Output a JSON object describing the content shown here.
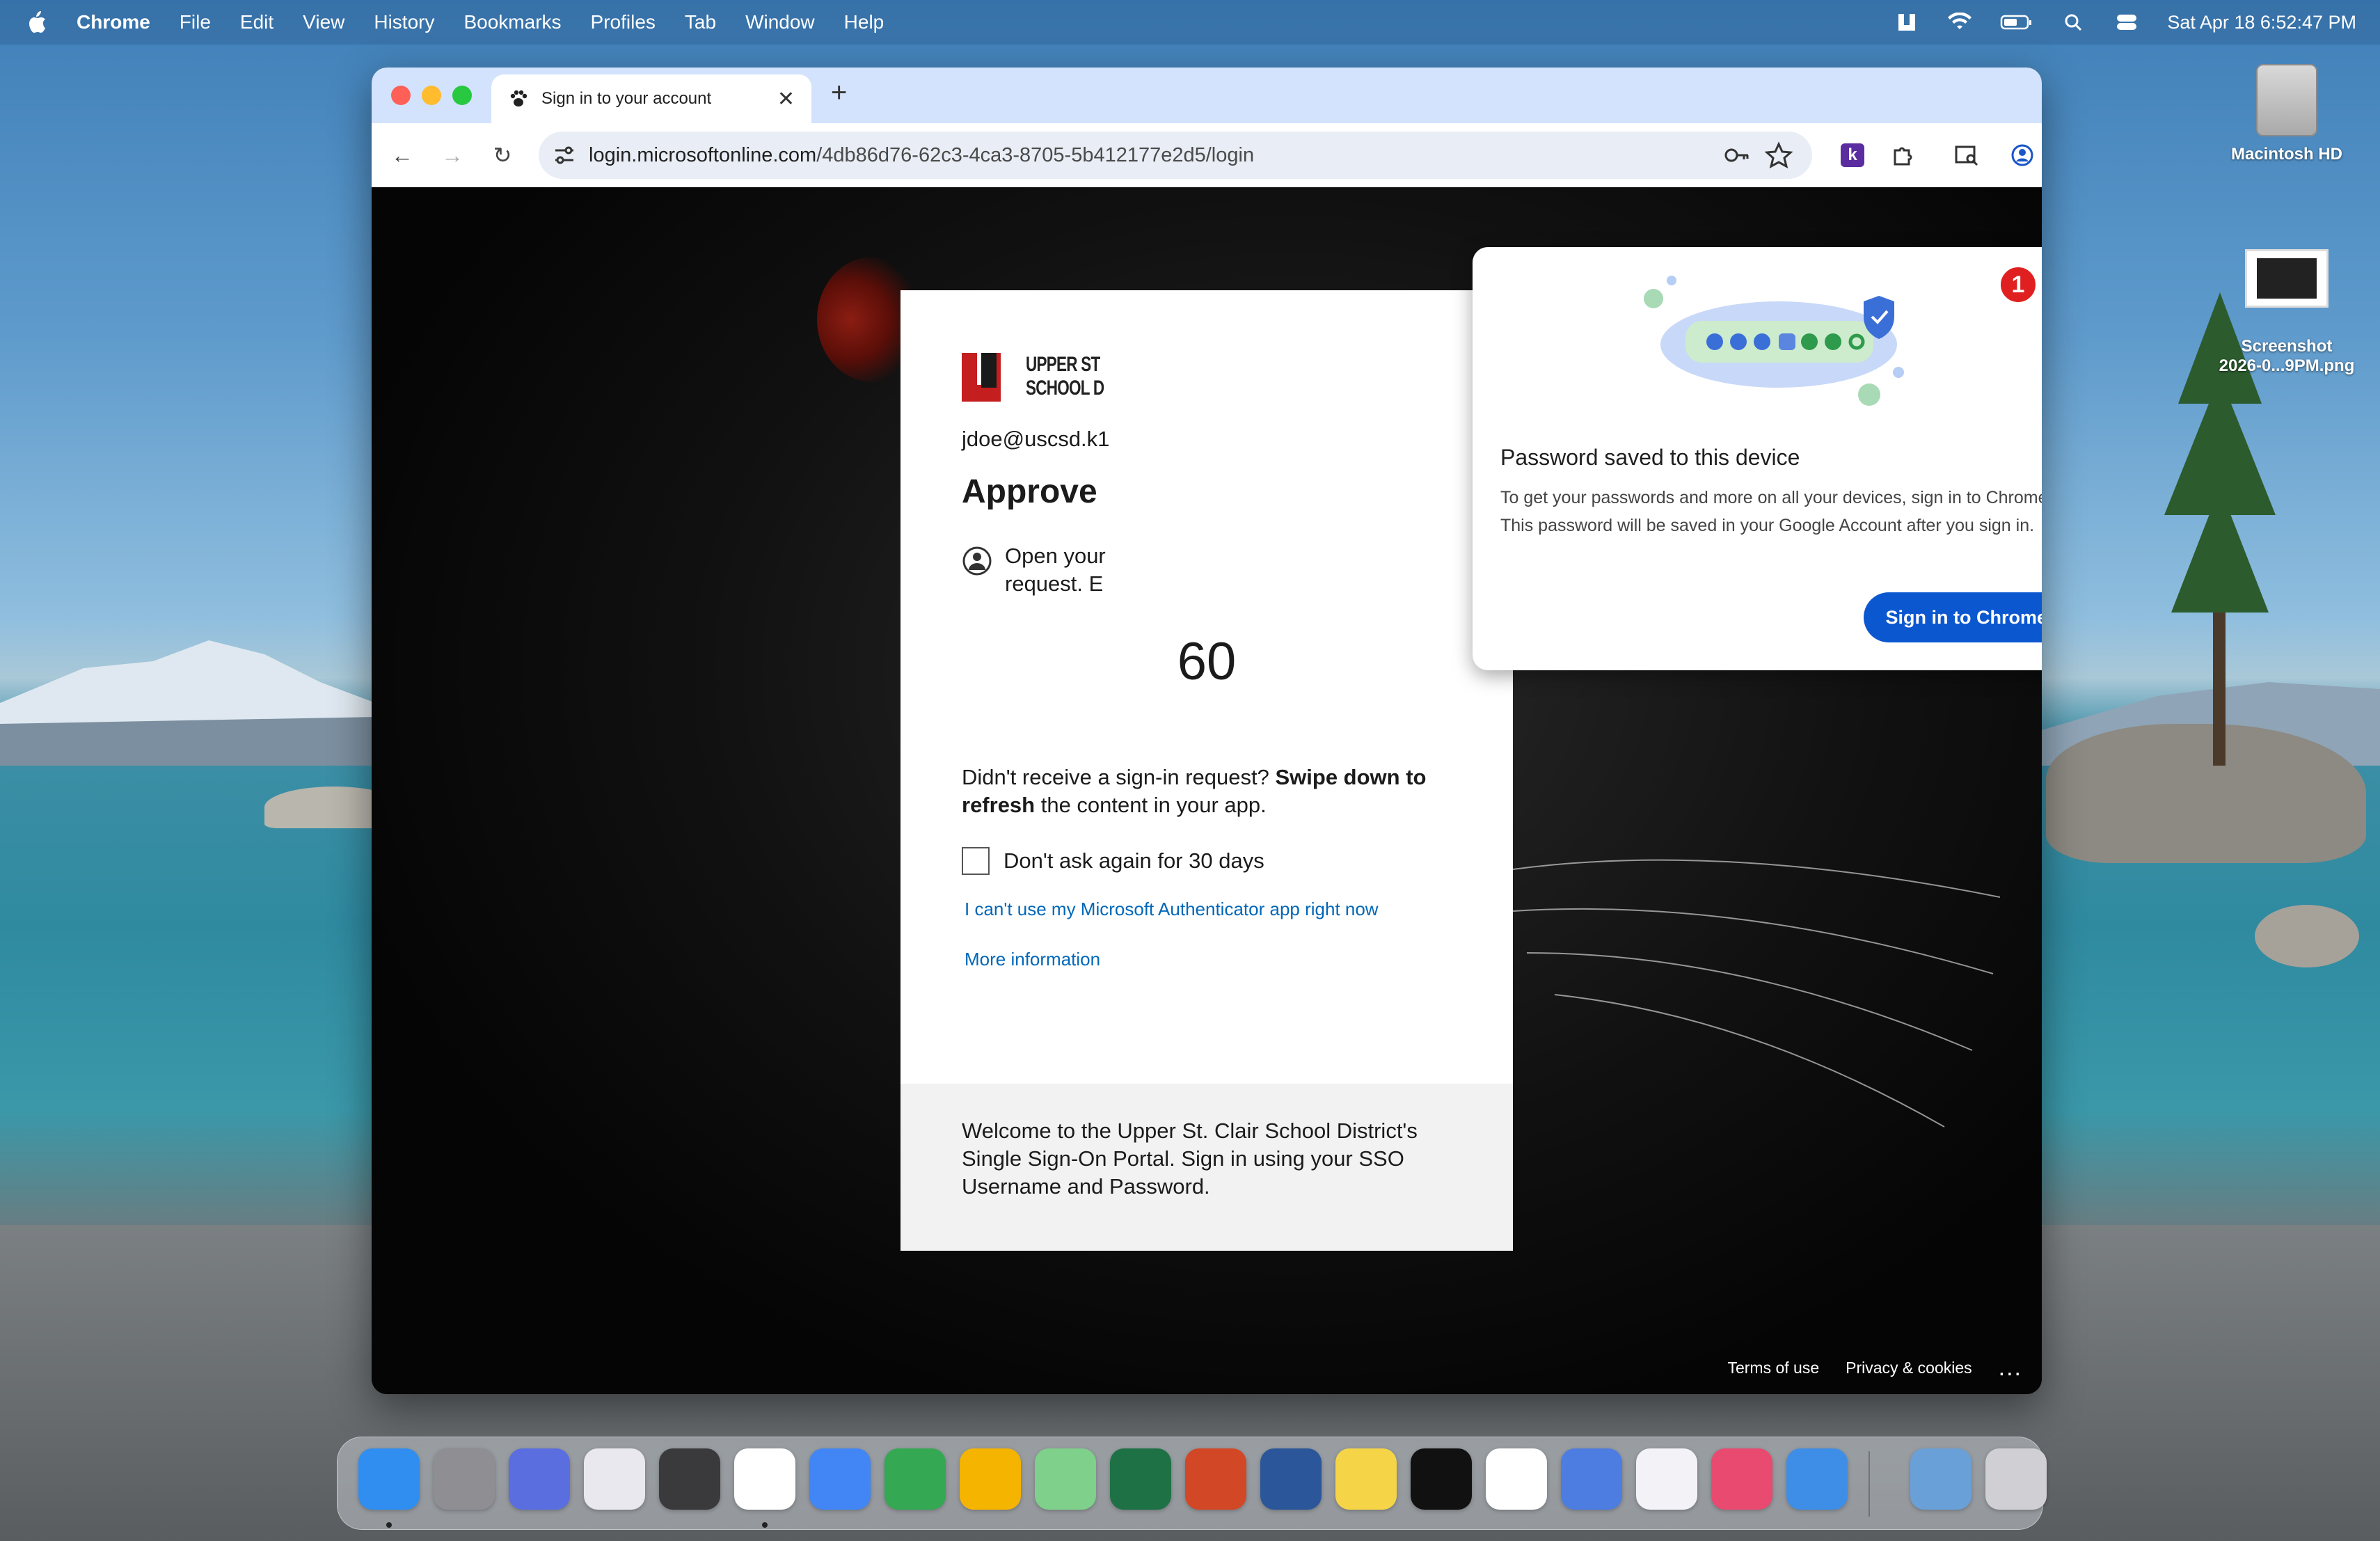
{
  "menubar": {
    "app_name": "Chrome",
    "items": [
      "File",
      "Edit",
      "View",
      "History",
      "Bookmarks",
      "Profiles",
      "Tab",
      "Window",
      "Help"
    ],
    "clock": "Sat Apr 18  6:52:47 PM"
  },
  "desktop": {
    "icons": [
      {
        "label": "Macintosh HD"
      },
      {
        "label": "Screenshot\n2026-0...9PM.png"
      }
    ]
  },
  "browser": {
    "tab_title": "Sign in to your account",
    "url_host": "login.microsoftonline.com",
    "url_path": "/4db86d76-62c3-4ca3-8705-5b412177e2d5/login"
  },
  "signin": {
    "logo_text_line1": "UPPER ST",
    "logo_text_line2": "SCHOOL D",
    "email": "jdoe@uscsd.k1",
    "title": "Approve",
    "auth_text_line1": "Open your",
    "auth_text_line2": "request. E",
    "number": "60",
    "didnt_prefix": "Didn't receive a sign-in request? ",
    "didnt_bold1": "Swipe down to",
    "didnt_bold2": "refresh",
    "didnt_suffix": " the content in your app.",
    "checkbox_label": "Don't ask again for 30 days",
    "cant_use_link": "I can't use my Microsoft Authenticator app right now",
    "more_info_link": "More information",
    "footer_text": "Welcome to the Upper St. Clair School District's Single Sign-On Portal. Sign in using your SSO Username and Password."
  },
  "page_footer": {
    "terms": "Terms of use",
    "privacy": "Privacy & cookies",
    "more": "..."
  },
  "password_bubble": {
    "badge": "1",
    "title": "Password saved to this device",
    "body": "To get your passwords and more on all your devices, sign in to Chrome. This password will be saved in your Google Account after you sign in.",
    "button": "Sign in to Chrome"
  },
  "dock": {
    "apps": [
      {
        "name": "Finder",
        "color": "#2f8ef0",
        "running": true
      },
      {
        "name": "System Settings",
        "color": "#8e8e93",
        "running": false
      },
      {
        "name": "iPhone Mirroring",
        "color": "#5a6ee0",
        "running": false
      },
      {
        "name": "Launchpad",
        "color": "#e8e8ee",
        "running": false
      },
      {
        "name": "Calculator",
        "color": "#3a3a3c",
        "running": false
      },
      {
        "name": "Google Chrome",
        "color": "#ffffff",
        "running": true
      },
      {
        "name": "Google Docs",
        "color": "#4285f4",
        "running": false
      },
      {
        "name": "Google Sheets",
        "color": "#34a853",
        "running": false
      },
      {
        "name": "Google Slides",
        "color": "#f4b400",
        "running": false
      },
      {
        "name": "Maps",
        "color": "#7fd08a",
        "running": false
      },
      {
        "name": "Excel",
        "color": "#1e7145",
        "running": false
      },
      {
        "name": "PowerPoint",
        "color": "#d24726",
        "running": false
      },
      {
        "name": "Word",
        "color": "#2b579a",
        "running": false
      },
      {
        "name": "Notes",
        "color": "#f5d547",
        "running": false
      },
      {
        "name": "TV",
        "color": "#111111",
        "running": false
      },
      {
        "name": "Photos",
        "color": "#ffffff",
        "running": false
      },
      {
        "name": "Screen Time",
        "color": "#4d7de0",
        "running": false
      },
      {
        "name": "Reminders",
        "color": "#f2f2f7",
        "running": false
      },
      {
        "name": "Shortcuts",
        "color": "#e94a6f",
        "running": false
      },
      {
        "name": "Weather",
        "color": "#3e8ee8",
        "running": false
      },
      {
        "name": "Downloads Folder",
        "color": "#6aa0d8",
        "running": false
      },
      {
        "name": "Trash",
        "color": "#d0d0d4",
        "running": false
      }
    ]
  }
}
